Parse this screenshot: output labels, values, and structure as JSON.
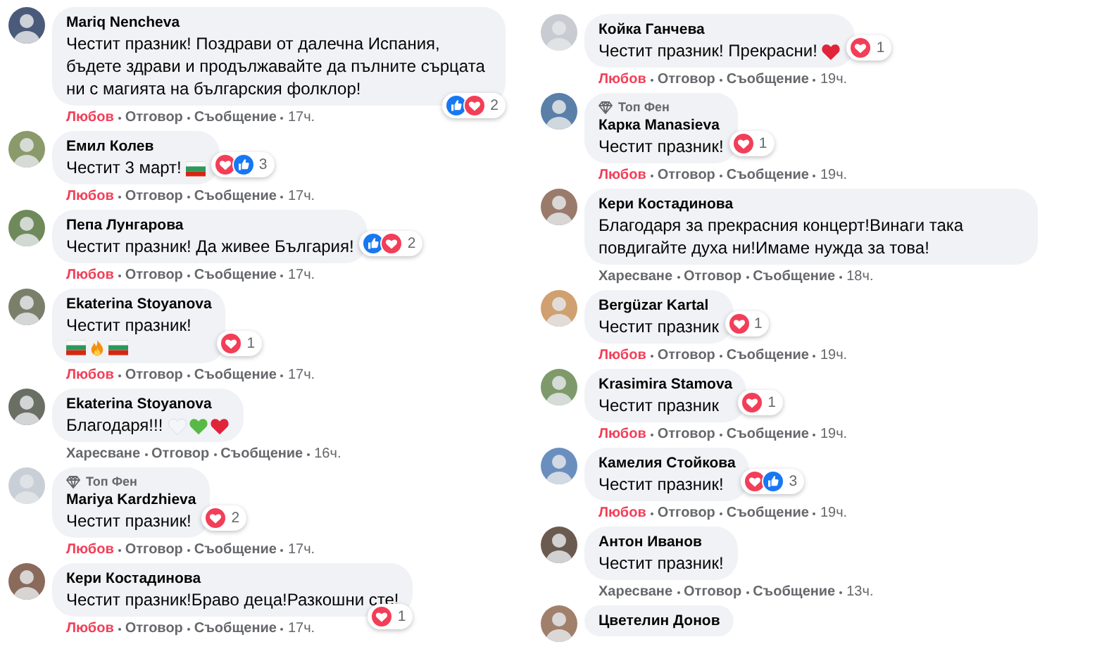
{
  "columns": [
    {
      "comments": [
        {
          "author": "Mariq Nencheva",
          "text": "Честит празник! Поздрави от далечна Испания, бъдете здрави и продължавайте да пълните сърцата ни с магията на българския фолклор!",
          "reaction": {
            "label": "Любов",
            "reacted": true
          },
          "reply": "Отговор",
          "message": "Съобщение",
          "time": "17ч.",
          "reactions": {
            "icons": [
              {
                "kind": "like"
              },
              {
                "kind": "love"
              }
            ],
            "count": "2"
          }
        },
        {
          "author": "Емил Колев",
          "text": "Честит 3 март!",
          "emojis": [
            {
              "kind": "flag"
            }
          ],
          "emojis_below": false,
          "reaction": {
            "label": "Любов",
            "reacted": true
          },
          "reply": "Отговор",
          "message": "Съобщение",
          "time": "17ч.",
          "reactions": {
            "icons": [
              {
                "kind": "love"
              },
              {
                "kind": "like"
              }
            ],
            "count": "3"
          }
        },
        {
          "author": "Пепа Лунгарова",
          "text": "Честит празник! Да живее България!",
          "reaction": {
            "label": "Любов",
            "reacted": true
          },
          "reply": "Отговор",
          "message": "Съобщение",
          "time": "17ч.",
          "reactions": {
            "icons": [
              {
                "kind": "like"
              },
              {
                "kind": "love"
              }
            ],
            "count": "2"
          }
        },
        {
          "author": "Ekaterina Stoyanova",
          "text": "Честит празник!",
          "emojis": [
            {
              "kind": "flag"
            },
            {
              "kind": "fire"
            },
            {
              "kind": "flag"
            }
          ],
          "emojis_below": true,
          "reaction": {
            "label": "Любов",
            "reacted": true
          },
          "reply": "Отговор",
          "message": "Съобщение",
          "time": "17ч.",
          "reactions": {
            "icons": [
              {
                "kind": "love"
              }
            ],
            "count": "1"
          }
        },
        {
          "author": "Ekaterina Stoyanova",
          "text": "Благодаря!!!",
          "emojis": [
            {
              "kind": "heart",
              "color": "#f4f6fa"
            },
            {
              "kind": "heart",
              "color": "#58b947"
            },
            {
              "kind": "heart",
              "color": "#e0243a"
            }
          ],
          "emojis_below": false,
          "reaction": {
            "label": "Харесване",
            "reacted": false
          },
          "reply": "Отговор",
          "message": "Съобщение",
          "time": "16ч."
        },
        {
          "author": "Mariya Kardzhieva",
          "top_fan": "Топ Фен",
          "text": "Честит празник!",
          "reaction": {
            "label": "Любов",
            "reacted": true
          },
          "reply": "Отговор",
          "message": "Съобщение",
          "time": "17ч.",
          "reactions": {
            "icons": [
              {
                "kind": "love"
              }
            ],
            "count": "2"
          }
        },
        {
          "author": "Кери Костадинова",
          "text": "Честит празник!Браво деца!Разкошни сте!",
          "reaction": {
            "label": "Любов",
            "reacted": true
          },
          "reply": "Отговор",
          "message": "Съобщение",
          "time": "17ч.",
          "reactions": {
            "icons": [
              {
                "kind": "love"
              }
            ],
            "count": "1"
          }
        }
      ]
    },
    {
      "comments": [
        {
          "author": "Койка Ганчева",
          "text": "Честит празник! Прекрасни!",
          "emojis": [
            {
              "kind": "heart",
              "color": "#e0243a"
            }
          ],
          "emojis_below": false,
          "reaction": {
            "label": "Любов",
            "reacted": true
          },
          "reply": "Отговор",
          "message": "Съобщение",
          "time": "19ч.",
          "reactions": {
            "icons": [
              {
                "kind": "love"
              }
            ],
            "count": "1"
          }
        },
        {
          "author": "Карка Manasieva",
          "top_fan": "Топ Фен",
          "text": "Честит празник!",
          "reaction": {
            "label": "Любов",
            "reacted": true
          },
          "reply": "Отговор",
          "message": "Съобщение",
          "time": "19ч.",
          "reactions": {
            "icons": [
              {
                "kind": "love"
              }
            ],
            "count": "1"
          }
        },
        {
          "author": "Кери Костадинова",
          "text": "Благодаря за прекрасния концерт!Винаги така повдигайте духа ни!Имаме нужда за това!",
          "reaction": {
            "label": "Харесване",
            "reacted": false
          },
          "reply": "Отговор",
          "message": "Съобщение",
          "time": "18ч."
        },
        {
          "author": "Bergüzar Kartal",
          "text": "Честит празник",
          "reaction": {
            "label": "Любов",
            "reacted": true
          },
          "reply": "Отговор",
          "message": "Съобщение",
          "time": "19ч.",
          "reactions": {
            "icons": [
              {
                "kind": "love"
              }
            ],
            "count": "1"
          }
        },
        {
          "author": "Krasimira Stamova",
          "text": "Честит празник",
          "reaction": {
            "label": "Любов",
            "reacted": true
          },
          "reply": "Отговор",
          "message": "Съобщение",
          "time": "19ч.",
          "reactions": {
            "icons": [
              {
                "kind": "love"
              }
            ],
            "count": "1"
          }
        },
        {
          "author": "Камелия Стойкова",
          "text": "Честит празник!",
          "reaction": {
            "label": "Любов",
            "reacted": true
          },
          "reply": "Отговор",
          "message": "Съобщение",
          "time": "19ч.",
          "reactions": {
            "icons": [
              {
                "kind": "love"
              },
              {
                "kind": "like"
              }
            ],
            "count": "3"
          }
        },
        {
          "author": "Антон Иванов",
          "text": "Честит празник!",
          "reaction": {
            "label": "Харесване",
            "reacted": false
          },
          "reply": "Отговор",
          "message": "Съобщение",
          "time": "13ч."
        },
        {
          "author": "Цветелин Донов"
        }
      ]
    }
  ]
}
